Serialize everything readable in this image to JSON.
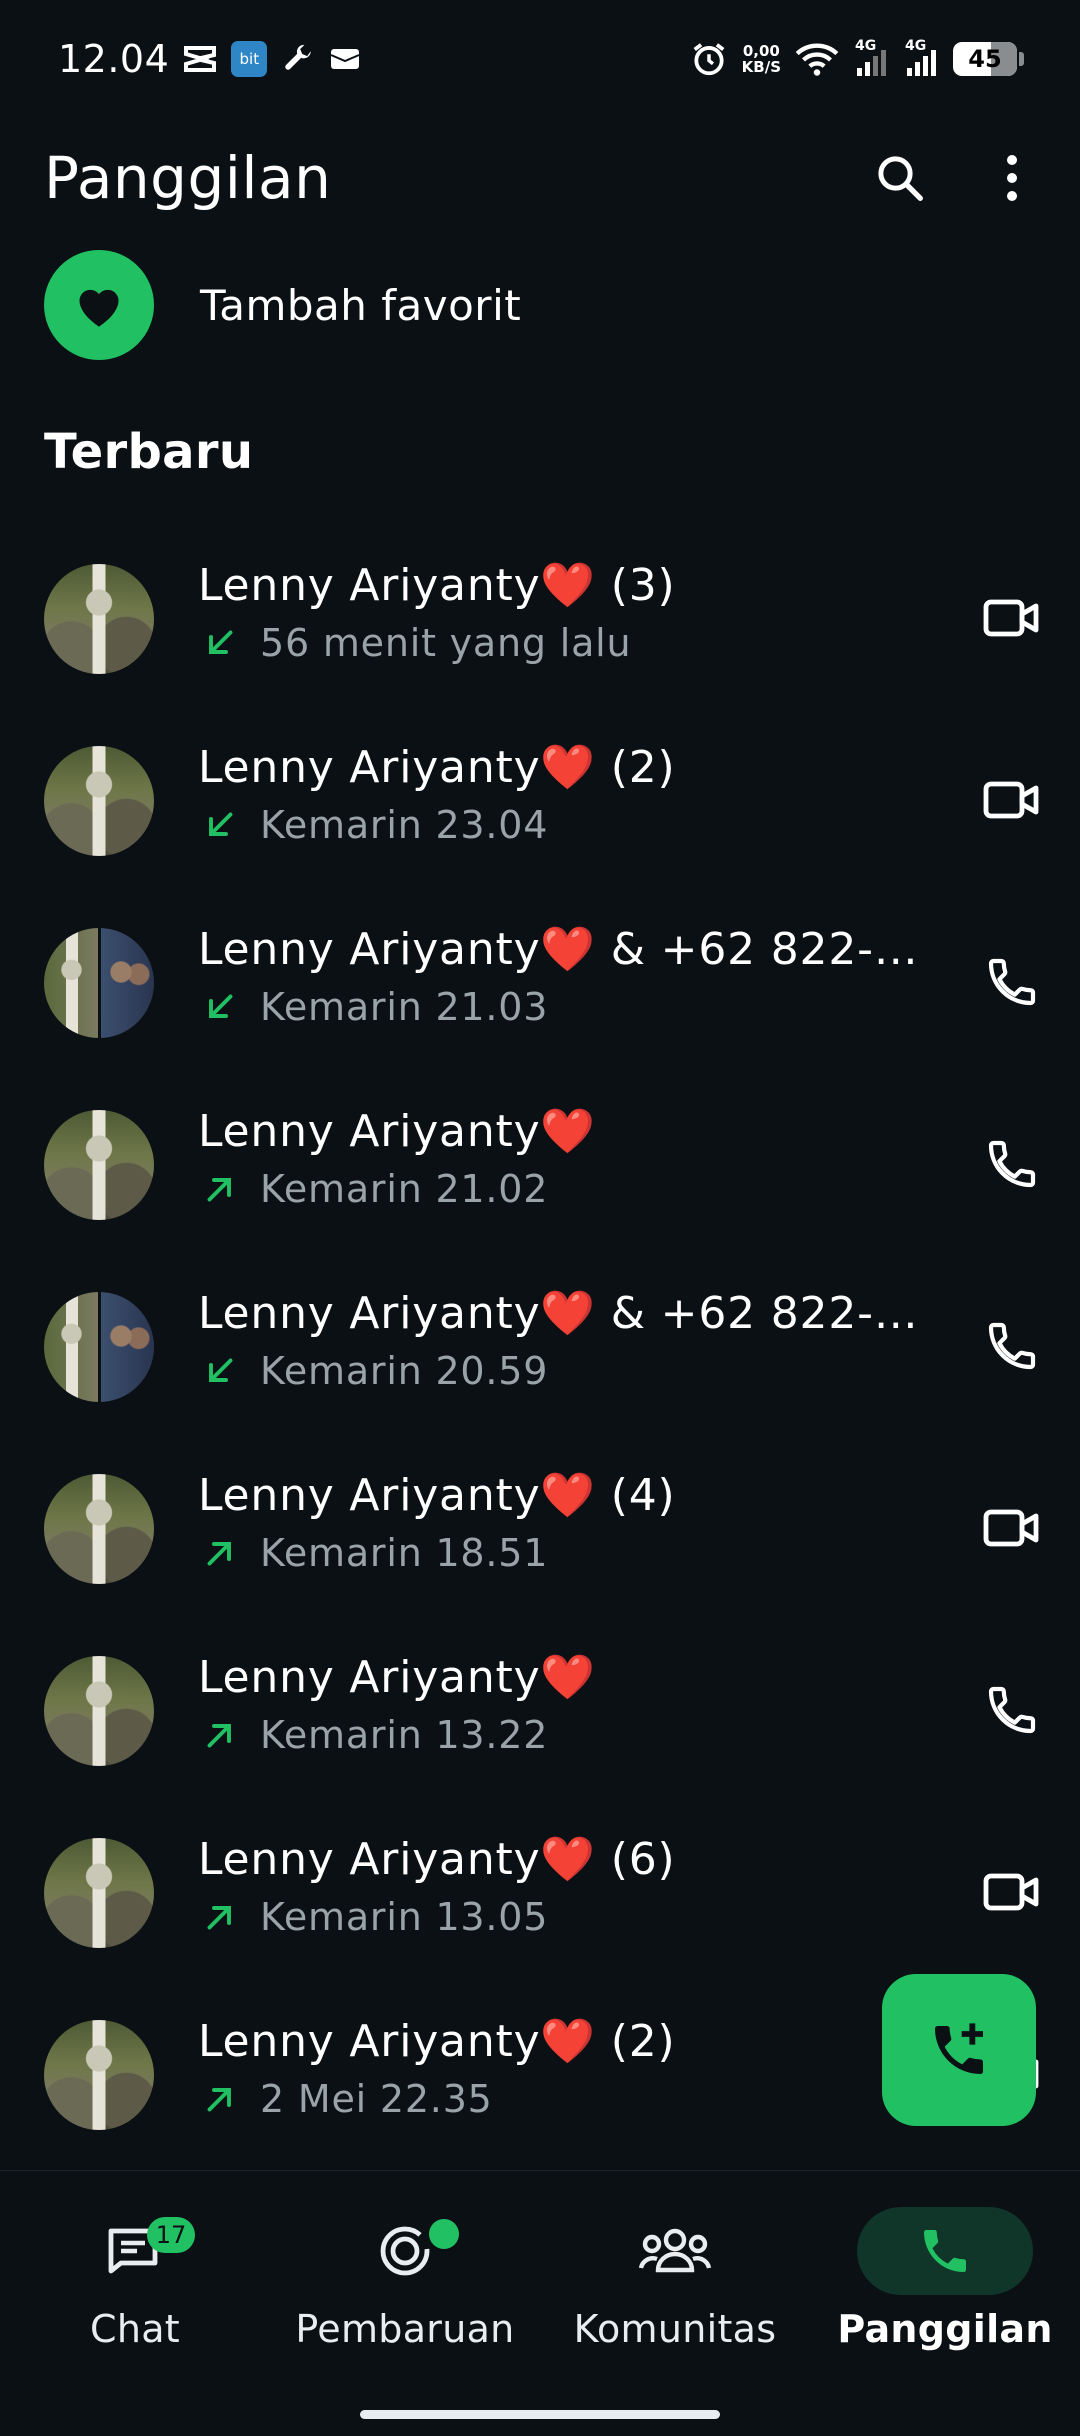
{
  "status_bar": {
    "time": "12.04",
    "net_speed_value": "0,00",
    "net_speed_unit": "KB/S",
    "sim1": "4G",
    "sim2": "4G",
    "battery": "45",
    "app_icon_text": "bit"
  },
  "header": {
    "title": "Panggilan"
  },
  "favorites": {
    "add_label": "Tambah favorit"
  },
  "recent": {
    "title": "Terbaru",
    "calls": [
      {
        "name": "Lenny Ariyanty",
        "suffix": " (3)",
        "direction": "incoming",
        "time": "56 menit yang lalu",
        "type": "video",
        "group": false
      },
      {
        "name": "Lenny Ariyanty",
        "suffix": " (2)",
        "direction": "incoming",
        "time": "Kemarin 23.04",
        "type": "video",
        "group": false
      },
      {
        "name": "Lenny Ariyanty",
        "suffix": " & +62 822-8...",
        "direction": "incoming",
        "time": "Kemarin 21.03",
        "type": "voice",
        "group": true
      },
      {
        "name": "Lenny Ariyanty",
        "suffix": "",
        "direction": "outgoing",
        "time": "Kemarin 21.02",
        "type": "voice",
        "group": false
      },
      {
        "name": "Lenny Ariyanty",
        "suffix": " & +62 822-8...",
        "direction": "incoming",
        "time": "Kemarin 20.59",
        "type": "voice",
        "group": true
      },
      {
        "name": "Lenny Ariyanty",
        "suffix": " (4)",
        "direction": "outgoing",
        "time": "Kemarin 18.51",
        "type": "video",
        "group": false
      },
      {
        "name": "Lenny Ariyanty",
        "suffix": "",
        "direction": "outgoing",
        "time": "Kemarin 13.22",
        "type": "voice",
        "group": false
      },
      {
        "name": "Lenny Ariyanty",
        "suffix": " (6)",
        "direction": "outgoing",
        "time": "Kemarin 13.05",
        "type": "video",
        "group": false
      },
      {
        "name": "Lenny Ariyanty",
        "suffix": " (2)",
        "direction": "outgoing",
        "time": "2 Mei 22.35",
        "type": "video",
        "group": false
      }
    ]
  },
  "nav": {
    "chat_label": "Chat",
    "chat_badge": "17",
    "updates_label": "Pembaruan",
    "communities_label": "Komunitas",
    "calls_label": "Panggilan"
  },
  "colors": {
    "background": "#0b1014",
    "accent": "#21c063",
    "heart": "#e8202a",
    "secondary_text": "#9aa3a8"
  }
}
